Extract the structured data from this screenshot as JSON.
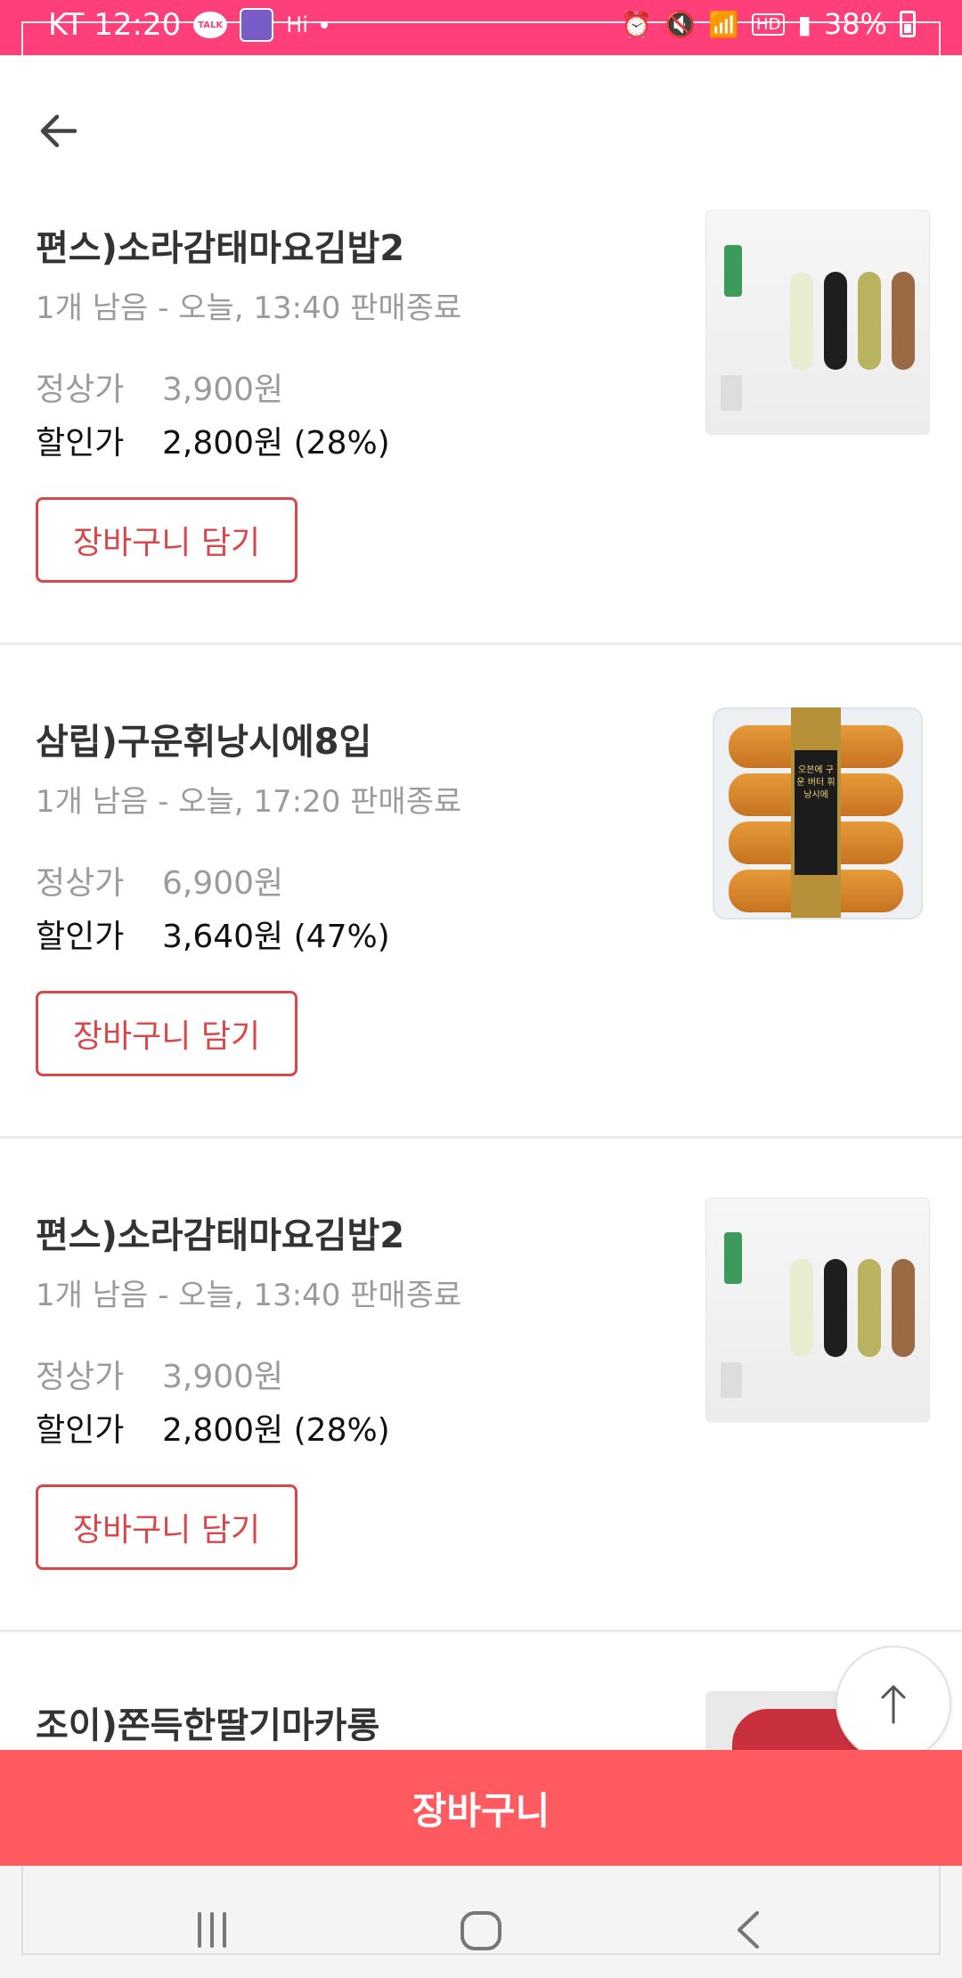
{
  "status_bar": {
    "carrier_time": "KT 12:20",
    "talk_badge": "TALK",
    "hi_text": "Hi",
    "battery": "38%",
    "icons": [
      "alarm-icon",
      "mute-icon",
      "wifi-icon",
      "hd-icon",
      "signal-icon",
      "battery-icon"
    ]
  },
  "header": {
    "back_icon": "arrow-left-icon"
  },
  "products": [
    {
      "name": "편스)소라감태마요김밥2",
      "availability": "1개 남음 - 오늘, 13:40 판매종료",
      "regular_label": "정상가",
      "regular_price": "3,900원",
      "discount_label": "할인가",
      "discount_price": "2,800원 (28%)",
      "cart_button": "장바구니 담기",
      "image": "kimbap"
    },
    {
      "name": "삼립)구운휘낭시에8입",
      "availability": "1개 남음 - 오늘, 17:20 판매종료",
      "regular_label": "정상가",
      "regular_price": "6,900원",
      "discount_label": "할인가",
      "discount_price": "3,640원 (47%)",
      "cart_button": "장바구니 담기",
      "image": "financier",
      "package_text": "오븐에 구운 버터 휘낭시에"
    },
    {
      "name": "편스)소라감태마요김밥2",
      "availability": "1개 남음 - 오늘, 13:40 판매종료",
      "regular_label": "정상가",
      "regular_price": "3,900원",
      "discount_label": "할인가",
      "discount_price": "2,800원 (28%)",
      "cart_button": "장바구니 담기",
      "image": "kimbap"
    },
    {
      "name": "조이)쫀득한딸기마카롱",
      "image": "macaron"
    }
  ],
  "scroll_top_icon": "arrow-up-icon",
  "cart_bar": {
    "label": "장바구니"
  },
  "nav_bar": {
    "icons": [
      "recent-apps-icon",
      "home-icon",
      "back-icon"
    ]
  },
  "colors": {
    "status_bar": "#ff3f7a",
    "accent": "#d9474b",
    "cart_bar": "#ff5a5f"
  }
}
